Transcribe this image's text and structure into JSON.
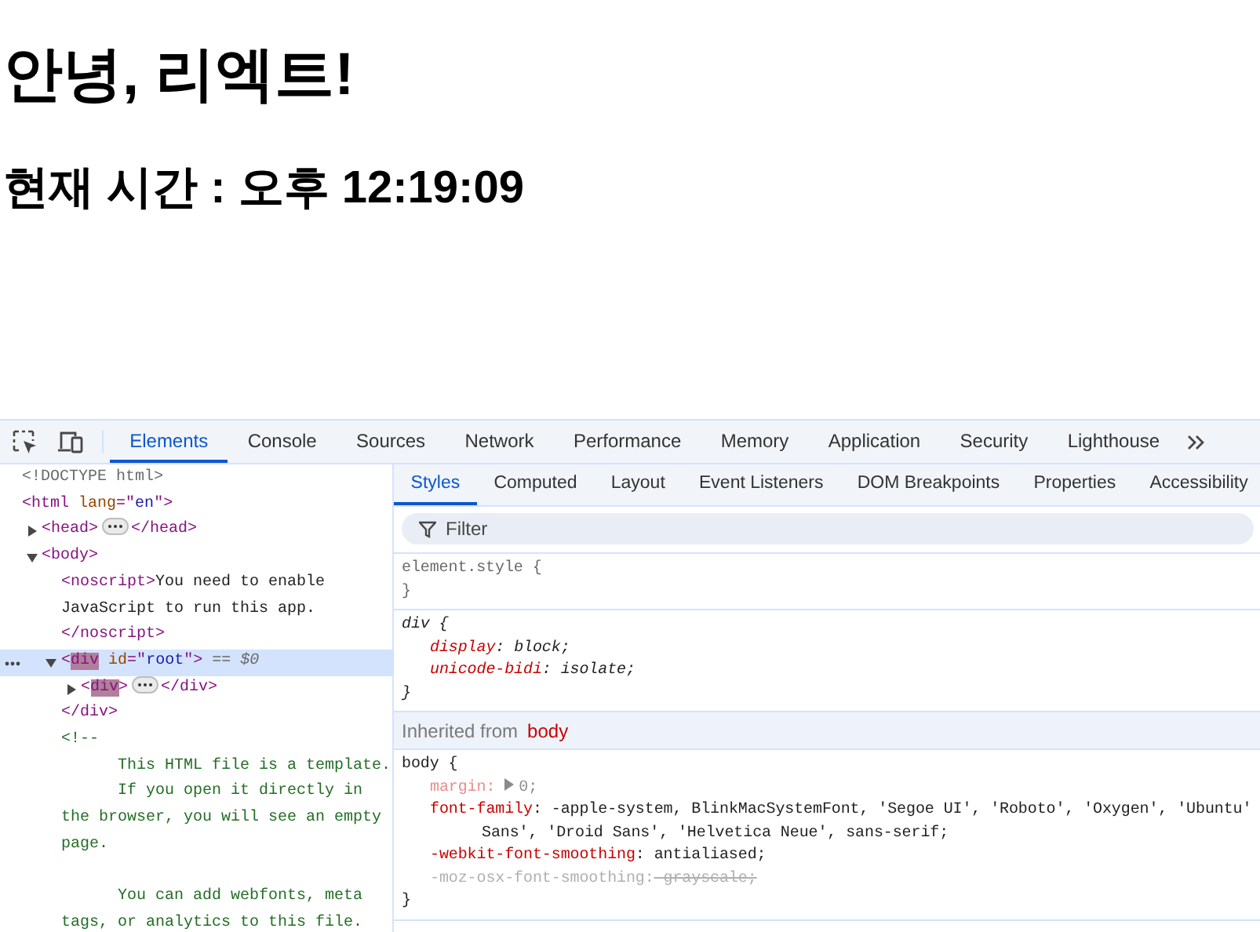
{
  "page": {
    "heading": "안녕, 리엑트!",
    "subheading": "현재 시간 : 오후 12:19:09"
  },
  "devtools": {
    "tabs": [
      {
        "label": "Elements",
        "selected": true
      },
      {
        "label": "Console",
        "selected": false
      },
      {
        "label": "Sources",
        "selected": false
      },
      {
        "label": "Network",
        "selected": false
      },
      {
        "label": "Performance",
        "selected": false
      },
      {
        "label": "Memory",
        "selected": false
      },
      {
        "label": "Application",
        "selected": false
      },
      {
        "label": "Security",
        "selected": false
      },
      {
        "label": "Lighthouse",
        "selected": false
      }
    ],
    "tree": [
      {
        "open": [
          {
            "kind": "doctype",
            "text": "<!DOCTYPE html>"
          }
        ],
        "selected": false
      },
      {
        "open": [
          {
            "kind": "tag",
            "text": "<html "
          },
          {
            "kind": "attr",
            "text": "lang"
          },
          {
            "kind": "tag",
            "text": "=\""
          },
          {
            "kind": "value",
            "text": "en"
          },
          {
            "kind": "tag",
            "text": "\">"
          }
        ],
        "selected": false,
        "children": [
          {
            "open": [
              {
                "kind": "tag",
                "text": "<head>"
              }
            ],
            "ellipsis": true,
            "close": [
              {
                "kind": "tag",
                "text": "</head>"
              }
            ],
            "expanded": false,
            "selected": false
          },
          {
            "open": [
              {
                "kind": "tag",
                "text": "<body>"
              }
            ],
            "expanded": true,
            "selected": false,
            "children": [
              {
                "open": [
                  {
                    "kind": "tag",
                    "text": "<noscript>"
                  },
                  {
                    "kind": "text",
                    "text": "You need to enable JavaScript to run this app. "
                  },
                  {
                    "kind": "tag",
                    "text": "</noscript>"
                  }
                ],
                "selected": false
              },
              {
                "open": [
                  {
                    "kind": "tag",
                    "text": "<"
                  },
                  {
                    "kind": "tag-highlight",
                    "text": "div"
                  },
                  {
                    "kind": "attr",
                    "text": " id"
                  },
                  {
                    "kind": "tag",
                    "text": "=\""
                  },
                  {
                    "kind": "value",
                    "text": "root"
                  },
                  {
                    "kind": "tag",
                    "text": "\">"
                  },
                  {
                    "kind": "ref",
                    "text": " == $0"
                  }
                ],
                "expanded": true,
                "selected": true,
                "end": [
                  {
                    "kind": "tag",
                    "text": "</div>"
                  }
                ],
                "children": [
                  {
                    "open": [
                      {
                        "kind": "tag",
                        "text": "<"
                      },
                      {
                        "kind": "tag-highlight",
                        "text": "div"
                      },
                      {
                        "kind": "tag",
                        "text": ">"
                      }
                    ],
                    "ellipsis": true,
                    "close": [
                      {
                        "kind": "tag",
                        "text": "</div>"
                      }
                    ],
                    "expanded": false,
                    "selected": false
                  }
                ]
              },
              {
                "open": [
                  {
                    "kind": "comment",
                    "text": "<!--\n      This HTML file is a template.\n      If you open it directly in the browser, you will see an empty page.\n\n      You can add webfonts, meta tags, or analytics to this file."
                  }
                ],
                "selected": false
              }
            ]
          }
        ]
      }
    ]
  },
  "styles": {
    "tabs": [
      {
        "label": "Styles",
        "selected": true
      },
      {
        "label": "Computed",
        "selected": false
      },
      {
        "label": "Layout",
        "selected": false
      },
      {
        "label": "Event Listeners",
        "selected": false
      },
      {
        "label": "DOM Breakpoints",
        "selected": false
      },
      {
        "label": "Properties",
        "selected": false
      },
      {
        "label": "Accessibility",
        "selected": false
      }
    ],
    "filter": {
      "placeholder": "Filter"
    },
    "rules": [
      {
        "kind": "inline",
        "selector": "element.style {",
        "close": "}"
      },
      {
        "kind": "user-agent",
        "selector": "div {",
        "close": "}",
        "declarations": [
          {
            "property": "display",
            "colon": ":",
            "value": " block;",
            "inactive": false,
            "overridden": false,
            "expandable": false
          },
          {
            "property": "unicode-bidi",
            "colon": ":",
            "value": " isolate;",
            "inactive": false,
            "overridden": false,
            "expandable": false
          }
        ]
      },
      {
        "kind": "inherited-header",
        "label": "Inherited from",
        "source": "body"
      },
      {
        "kind": "author",
        "selector": "body {",
        "close": "}",
        "declarations": [
          {
            "property": "margin",
            "colon": ":",
            "value": "0;",
            "inactive": true,
            "overridden": false,
            "expandable": true
          },
          {
            "property": "font-family",
            "colon": ":",
            "value": " -apple-system, BlinkMacSystemFont, 'Segoe UI', 'Roboto', 'Oxygen', 'Ubuntu'",
            "continuation": "Sans', 'Droid Sans', 'Helvetica Neue', sans-serif;",
            "inactive": false,
            "overridden": false,
            "expandable": false
          },
          {
            "property": "-webkit-font-smoothing",
            "colon": ":",
            "value": " antialiased;",
            "inactive": false,
            "overridden": false,
            "expandable": false
          },
          {
            "property": "-moz-osx-font-smoothing",
            "colon": ":",
            "value": " grayscale;",
            "inactive": true,
            "overridden": true,
            "expandable": false
          }
        ]
      }
    ]
  }
}
